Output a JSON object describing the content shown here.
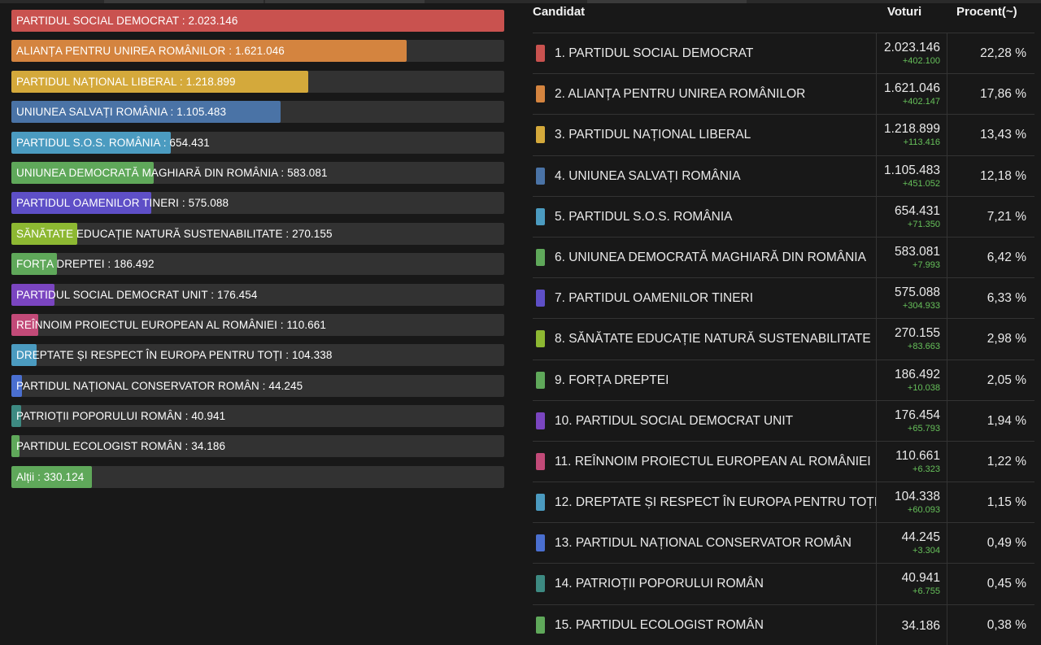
{
  "chart_data": {
    "type": "bar",
    "orientation": "horizontal",
    "xlim": [
      0,
      2023146
    ],
    "grid": false,
    "bars": [
      {
        "label": "PARTIDUL SOCIAL DEMOCRAT : 2.023.146",
        "value": 2023146,
        "color": "#c9524f"
      },
      {
        "label": "ALIANȚA PENTRU UNIREA ROMÂNILOR : 1.621.046",
        "value": 1621046,
        "color": "#d4843f"
      },
      {
        "label": "PARTIDUL NAȚIONAL LIBERAL : 1.218.899",
        "value": 1218899,
        "color": "#d4a93b"
      },
      {
        "label": "UNIUNEA SALVAȚI ROMÂNIA : 1.105.483",
        "value": 1105483,
        "color": "#4a73a6"
      },
      {
        "label": "PARTIDUL S.O.S. ROMÂNIA : 654.431",
        "value": 654431,
        "color": "#4b9bc0"
      },
      {
        "label": "UNIUNEA DEMOCRATĂ MAGHIARĂ DIN ROMÂNIA : 583.081",
        "value": 583081,
        "color": "#5fa85a"
      },
      {
        "label": "PARTIDUL OAMENILOR TINERI : 575.088",
        "value": 575088,
        "color": "#5e4fc7"
      },
      {
        "label": "SĂNĂTATE EDUCAȚIE NATURĂ SUSTENABILITATE : 270.155",
        "value": 270155,
        "color": "#8db832"
      },
      {
        "label": "FORȚA DREPTEI : 186.492",
        "value": 186492,
        "color": "#5fa85a"
      },
      {
        "label": "PARTIDUL SOCIAL DEMOCRAT UNIT : 176.454",
        "value": 176454,
        "color": "#7a45c0"
      },
      {
        "label": "REÎNNOIM PROIECTUL EUROPEAN AL ROMÂNIEI : 110.661",
        "value": 110661,
        "color": "#c24a78"
      },
      {
        "label": "DREPTATE ȘI RESPECT ÎN EUROPA PENTRU TOȚI : 104.338",
        "value": 104338,
        "color": "#4b9bc0"
      },
      {
        "label": "PARTIDUL NAȚIONAL CONSERVATOR ROMÂN : 44.245",
        "value": 44245,
        "color": "#4a6fd0"
      },
      {
        "label": "PATRIOȚII POPORULUI ROMÂN : 40.941",
        "value": 40941,
        "color": "#3d8a82"
      },
      {
        "label": "PARTIDUL ECOLOGIST ROMÂN : 34.186",
        "value": 34186,
        "color": "#5fa85a"
      },
      {
        "label": "Alții : 330.124",
        "value": 330124,
        "color": "#5fa85a"
      }
    ]
  },
  "table": {
    "headers": {
      "candidate": "Candidat",
      "votes": "Voturi",
      "percent": "Procent(~)"
    },
    "rows": [
      {
        "name": "1. PARTIDUL SOCIAL DEMOCRAT",
        "votes": "2.023.146",
        "delta": "+402.100",
        "percent": "22,28 %",
        "color": "#c9524f"
      },
      {
        "name": "2. ALIANȚA PENTRU UNIREA ROMÂNILOR",
        "votes": "1.621.046",
        "delta": "+402.147",
        "percent": "17,86 %",
        "color": "#d4843f"
      },
      {
        "name": "3. PARTIDUL NAȚIONAL LIBERAL",
        "votes": "1.218.899",
        "delta": "+113.416",
        "percent": "13,43 %",
        "color": "#d4a93b"
      },
      {
        "name": "4. UNIUNEA SALVAȚI ROMÂNIA",
        "votes": "1.105.483",
        "delta": "+451.052",
        "percent": "12,18 %",
        "color": "#4a73a6"
      },
      {
        "name": "5. PARTIDUL S.O.S. ROMÂNIA",
        "votes": "654.431",
        "delta": "+71.350",
        "percent": "7,21 %",
        "color": "#4b9bc0"
      },
      {
        "name": "6. UNIUNEA DEMOCRATĂ MAGHIARĂ DIN ROMÂNIA",
        "votes": "583.081",
        "delta": "+7.993",
        "percent": "6,42 %",
        "color": "#5fa85a"
      },
      {
        "name": "7. PARTIDUL OAMENILOR TINERI",
        "votes": "575.088",
        "delta": "+304.933",
        "percent": "6,33 %",
        "color": "#5e4fc7"
      },
      {
        "name": "8. SĂNĂTATE EDUCAȚIE NATURĂ SUSTENABILITATE",
        "votes": "270.155",
        "delta": "+83.663",
        "percent": "2,98 %",
        "color": "#8db832"
      },
      {
        "name": "9. FORȚA DREPTEI",
        "votes": "186.492",
        "delta": "+10.038",
        "percent": "2,05 %",
        "color": "#5fa85a"
      },
      {
        "name": "10. PARTIDUL SOCIAL DEMOCRAT UNIT",
        "votes": "176.454",
        "delta": "+65.793",
        "percent": "1,94 %",
        "color": "#7a45c0"
      },
      {
        "name": "11. REÎNNOIM PROIECTUL EUROPEAN AL ROMÂNIEI",
        "votes": "110.661",
        "delta": "+6.323",
        "percent": "1,22 %",
        "color": "#c24a78"
      },
      {
        "name": "12. DREPTATE ȘI RESPECT ÎN EUROPA PENTRU TOȚI",
        "votes": "104.338",
        "delta": "+60.093",
        "percent": "1,15 %",
        "color": "#4b9bc0"
      },
      {
        "name": "13. PARTIDUL NAȚIONAL CONSERVATOR ROMÂN",
        "votes": "44.245",
        "delta": "+3.304",
        "percent": "0,49 %",
        "color": "#4a6fd0"
      },
      {
        "name": "14. PATRIOȚII POPORULUI ROMÂN",
        "votes": "40.941",
        "delta": "+6.755",
        "percent": "0,45 %",
        "color": "#3d8a82"
      },
      {
        "name": "15. PARTIDUL ECOLOGIST ROMÂN",
        "votes": "34.186",
        "delta": "",
        "percent": "0,38 %",
        "color": "#5fa85a"
      }
    ]
  }
}
